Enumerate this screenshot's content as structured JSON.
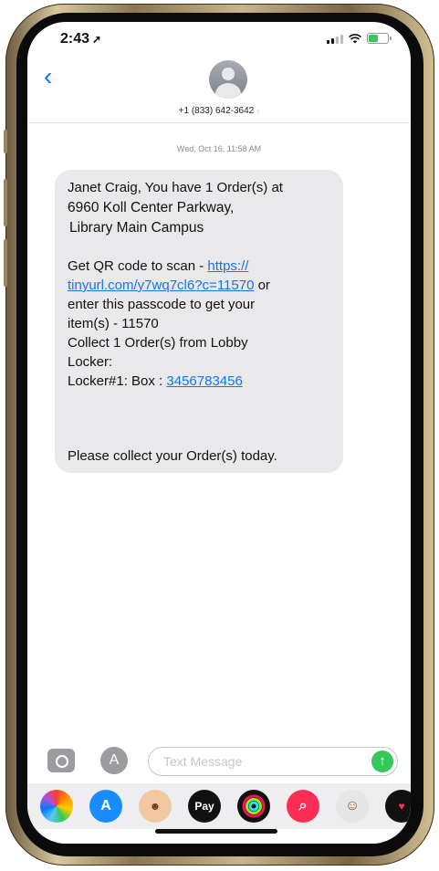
{
  "status_bar": {
    "time": "2:43",
    "location_icon": "location-arrow-icon",
    "signal_icon": "cellular-signal-icon",
    "wifi_icon": "wifi-icon",
    "battery_icon": "battery-icon"
  },
  "header": {
    "back_icon": "chevron-left-icon",
    "contact_avatar_icon": "person-avatar-icon",
    "contact_number": "+1 (833) 642-3642",
    "chevron_icon": "chevron-right-icon"
  },
  "conversation": {
    "timestamp": "Wed, Oct 16, 11:58 AM",
    "message": {
      "greeting": "Janet Craig,  You have 1 Order(s)  at",
      "address_line1": "6960 Koll Center Parkway,",
      "address_line2": "Library Main Campus",
      "qr_prefix": "Get QR code to scan - ",
      "qr_link_part1": "https://",
      "qr_link_part2": "tinyurl.com/y7wq7cl6?c=11570",
      "qr_suffix": " or",
      "passcode_line1": "enter this passcode to get your",
      "passcode_line2": "item(s) - 11570",
      "collect_line1": "Collect 1 Order(s) from Lobby",
      "collect_line2": "Locker:",
      "locker_prefix": "Locker#1: Box : ",
      "locker_number": "3456783456",
      "closing": "Please collect your Order(s) today."
    }
  },
  "composer": {
    "camera_icon": "camera-icon",
    "appstore_icon": "app-store-icon",
    "placeholder": "Text Message",
    "send_icon": "arrow-up-icon"
  },
  "app_drawer": {
    "apps": [
      {
        "name": "photos-icon",
        "color": "#ffffff"
      },
      {
        "name": "app-store-icon",
        "color": "#1a8cff"
      },
      {
        "name": "memoji-icon",
        "color": "#f2c8a0"
      },
      {
        "name": "apple-pay-icon",
        "label": "Pay",
        "color": "#111111"
      },
      {
        "name": "activity-rings-icon",
        "color": "#111111"
      },
      {
        "name": "search-images-icon",
        "color": "#ff2d55"
      },
      {
        "name": "animoji-monkey-icon",
        "color": "#e6e6e6"
      },
      {
        "name": "digital-touch-icon",
        "color": "#111111"
      }
    ]
  },
  "colors": {
    "link": "#1a73e8",
    "bubble": "#e9e9eb",
    "send": "#34c759"
  }
}
